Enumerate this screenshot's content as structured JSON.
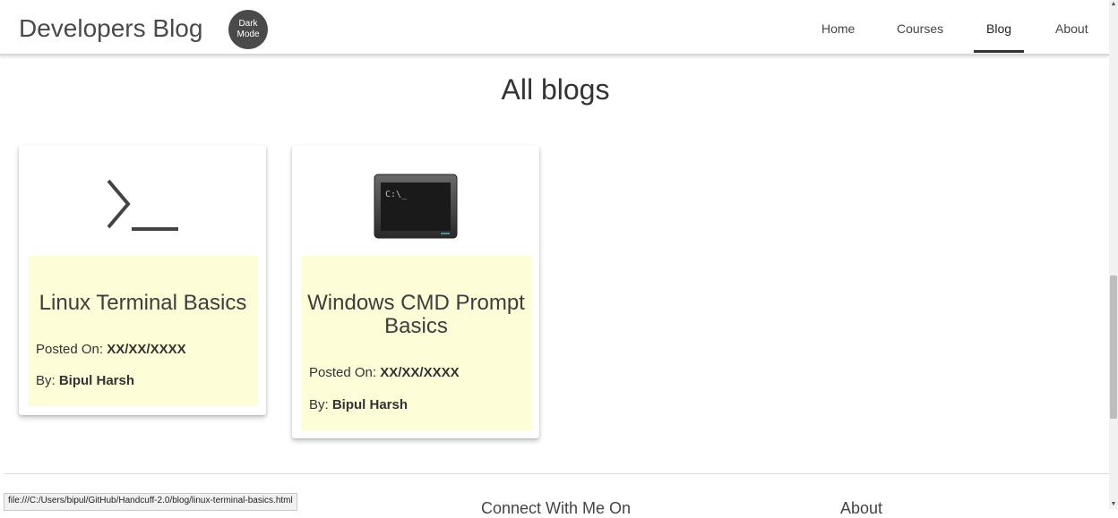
{
  "header": {
    "brand": "Developers Blog",
    "dark_mode_label": "Dark Mode",
    "nav": [
      "Home",
      "Courses",
      "Blog",
      "About"
    ],
    "active_nav": "Blog"
  },
  "main": {
    "title": "All blogs",
    "cards": [
      {
        "image_icon": "terminal-prompt-icon",
        "title": "Linux Terminal Basics",
        "posted_label": "Posted On: ",
        "posted_value": "XX/XX/XXXX",
        "by_label": "By: ",
        "by_value": "Bipul Harsh"
      },
      {
        "image_icon": "cmd-window-icon",
        "title": "Windows CMD Prompt Basics",
        "posted_label": "Posted On: ",
        "posted_value": "XX/XX/XXXX",
        "by_label": "By: ",
        "by_value": "Bipul Harsh"
      }
    ]
  },
  "footer": {
    "connect": "Connect With Me On",
    "about": "About"
  },
  "status_bar": {
    "url": "file:///C:/Users/bipul/GitHub/Handcuff-2.0/blog/linux-terminal-basics.html"
  },
  "colors": {
    "card_body_bg": "#fdfdd8",
    "dark_button_bg": "#4a4a4a"
  }
}
